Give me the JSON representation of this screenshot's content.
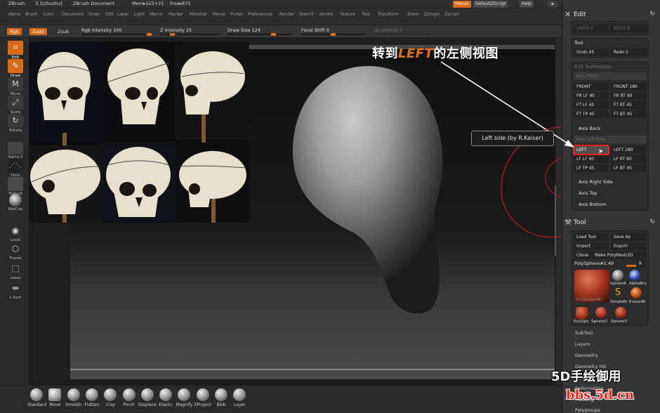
{
  "titlebar": {
    "app": "ZBrush",
    "version": "3.1[zhuzhu]",
    "document": "ZBrush Document",
    "mem": "Mem▸123+31",
    "free": "Free▸875",
    "menus_btn": "Menus",
    "script_btn": "DefaultZScript",
    "help_btn": "Help"
  },
  "menubar": [
    "Alpha",
    "Brush",
    "Color",
    "Document",
    "Draw",
    "Edit",
    "Layer",
    "Light",
    "Macro",
    "Marker",
    "Material",
    "Movie",
    "Picker",
    "Preferences",
    "Render",
    "Stencil",
    "Stroke",
    "Texture",
    "Tool",
    "Transform",
    "Zoom",
    "Zplugin",
    "Zscript"
  ],
  "options": {
    "rgb": "Rgb",
    "zadd": "Zadd",
    "zsub": "Zsub",
    "rgb_intensity": "Rgb Intensity 100",
    "rgb_intensity_level": 1.0,
    "z_intensity": "Z Intensity 25",
    "z_intensity_level": 0.25,
    "draw_size": "Draw Size 124",
    "draw_size_level": 0.5,
    "focal_shift": "Focal Shift 0",
    "focal_shift_level": 0.0,
    "brushmod": "BrushMod 0"
  },
  "left_tools": [
    {
      "label": "Edit",
      "icon": "edit-icon",
      "active": true
    },
    {
      "label": "Draw",
      "icon": "draw-icon",
      "active": true
    },
    {
      "label": "Move",
      "icon": "move-icon",
      "active": false
    },
    {
      "label": "Scale",
      "icon": "scale-icon",
      "active": false
    },
    {
      "label": "Rotate",
      "icon": "rotate-icon",
      "active": false
    }
  ],
  "left_swatches": {
    "alpha": "Alpha",
    "alpha_num": "0",
    "dots": "Dots",
    "texture": "Texture",
    "matcap": "MatCap",
    "local": "Local",
    "frame": "Frame",
    "lasso": "Lasso",
    "lsym": "L.Sym"
  },
  "annotation": {
    "title_prefix": "转到",
    "title_highlight": "LEFT",
    "title_suffix": "的左侧视图",
    "tooltip": "Left side (by R.Kaiser)"
  },
  "edit_panel": {
    "title": "Edit",
    "undo_disabled": "UNDO 5",
    "redo_disabled": "REDO 6",
    "tool_label": "Tool",
    "undo": "Undo 45",
    "redo": "Redo 1"
  },
  "xyz": {
    "title": "XYZ ToolPosition",
    "axis_front": "Axis Front",
    "front_buttons": [
      "FRONT",
      "FRONT 180",
      "FR LF 90",
      "FR RT 90",
      "FT LF 45",
      "FT RT 45",
      "FT TP 45",
      "FT BT 45"
    ],
    "axis_back": "Axis Back",
    "axis_left": "Axis Left Side",
    "left_buttons": [
      "LEFT",
      "LEFT 180",
      "LF LF 90",
      "LF RT 90",
      "LF TP 45",
      "LF BT 45"
    ],
    "axis_right": "Axis Right Side",
    "axis_top": "Axis Top",
    "axis_bottom": "Axis Bottom"
  },
  "tool_panel": {
    "title": "Tool",
    "load": "Load Tool",
    "save": "Save As",
    "import": "Import",
    "export": "Export",
    "clone": "Clone",
    "make": "Make PolyMesh3D",
    "current": "PolySphere#1.49",
    "r": "R",
    "thumbs": [
      "PolySphere#1",
      "Sphere8",
      "AlphaBru",
      "SimpleBr",
      "EraserBr",
      "PolySph",
      "Sphere3",
      "Sphere3"
    ],
    "sections": [
      "SubTool",
      "Layers",
      "Geometry",
      "Geometry HD",
      "Deformation",
      "Masking",
      "Polygroups"
    ]
  },
  "bottom_tools": [
    "Standard",
    "Move",
    "Smooth",
    "Flatten",
    "Clay",
    "Pinch",
    "Displace",
    "Elastic",
    "Magnify",
    "ZProject",
    "Blob",
    "Layer"
  ],
  "watermark": {
    "line1": "5D手绘御用",
    "line2": "bbs.5d.cn"
  },
  "colors": {
    "accent": "#d96a17",
    "highlight_box": "#ff1c1c",
    "watermark_red": "#e8281c"
  }
}
